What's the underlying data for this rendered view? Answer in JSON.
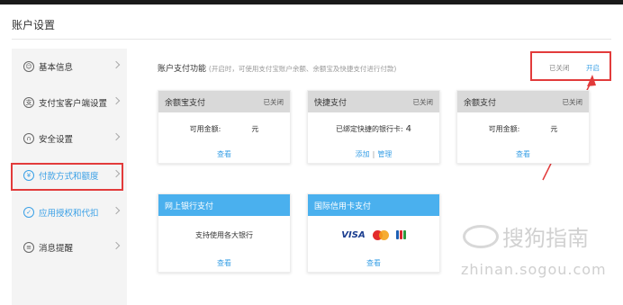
{
  "page": {
    "title": "账户设置"
  },
  "sidebar": {
    "items": [
      {
        "label": "基本信息",
        "icon": "user-icon",
        "glyph": "☺"
      },
      {
        "label": "支付宝客户端设置",
        "icon": "alipay-client-icon",
        "glyph": "支"
      },
      {
        "label": "安全设置",
        "icon": "lock-icon",
        "glyph": "∩"
      },
      {
        "label": "付款方式和额度",
        "icon": "yuan-icon",
        "glyph": "¥"
      },
      {
        "label": "应用授权和代扣",
        "icon": "check-icon",
        "glyph": "✓"
      },
      {
        "label": "消息提醒",
        "icon": "message-icon",
        "glyph": "≡"
      }
    ]
  },
  "section": {
    "title": "账户支付功能",
    "hint": "(开启时，可使用支付宝账户余额、余额宝及快捷支付进行付款)",
    "status_off": "已关闭",
    "status_on": "开启"
  },
  "cards": [
    {
      "title": "余额宝支付",
      "status": "已关闭",
      "body_label": "可用金额:",
      "body_value": "元",
      "footer": "查看"
    },
    {
      "title": "快捷支付",
      "status": "已关闭",
      "body_label": "已绑定快捷的银行卡:",
      "body_value": "4",
      "footer_add": "添加",
      "footer_sep": "|",
      "footer_manage": "管理"
    },
    {
      "title": "余额支付",
      "status": "已关闭",
      "body_label": "可用金额:",
      "body_value": "元",
      "footer": "查看"
    },
    {
      "title": "网上银行支付",
      "body_label": "支持使用各大银行",
      "footer": "查看"
    },
    {
      "title": "国际信用卡支付",
      "visa": "VISA",
      "footer": "查看"
    }
  ],
  "colors": {
    "accent": "#3aa0e6",
    "highlight": "#e23b3b",
    "card_header_blue": "#4ab0ee",
    "card_header_gray": "#d9d9d9"
  },
  "watermark": {
    "text": "搜狗指南",
    "url": "zhinan.sogou.com"
  }
}
